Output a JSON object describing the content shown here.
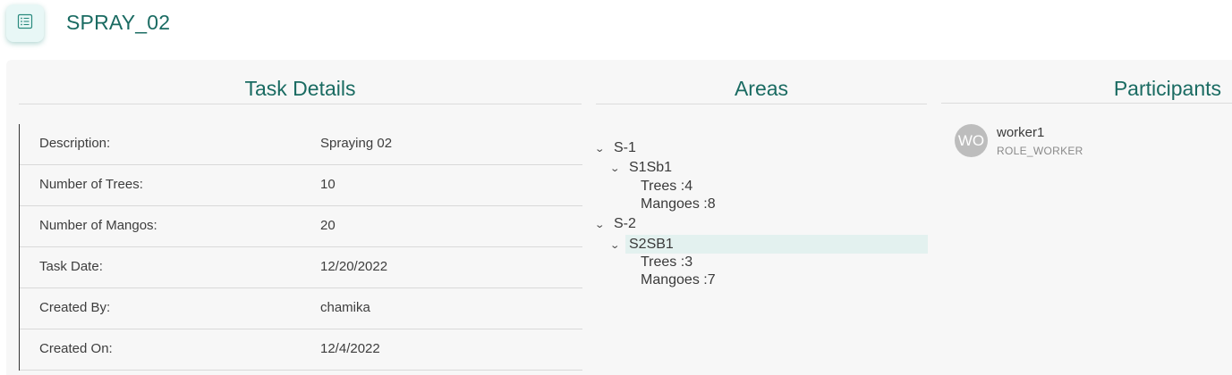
{
  "header": {
    "title": "SPRAY_02",
    "icon": "list-icon"
  },
  "sections": {
    "details_title": "Task Details",
    "areas_title": "Areas",
    "participants_title": "Participants"
  },
  "task_details": [
    {
      "label": "Description:",
      "value": "Spraying 02"
    },
    {
      "label": "Number of Trees:",
      "value": "10"
    },
    {
      "label": "Number of Mangos:",
      "value": "20"
    },
    {
      "label": "Task Date:",
      "value": "12/20/2022"
    },
    {
      "label": "Created By:",
      "value": "chamika"
    },
    {
      "label": "Created On:",
      "value": "12/4/2022"
    }
  ],
  "areas": {
    "nodes": [
      {
        "label": "S-1"
      },
      {
        "label": "S1Sb1"
      },
      {
        "label": "Trees :4"
      },
      {
        "label": "Mangoes :8"
      },
      {
        "label": "S-2"
      },
      {
        "label": "S2SB1",
        "selected": true
      },
      {
        "label": "Trees :3"
      },
      {
        "label": "Mangoes :7"
      }
    ]
  },
  "participants": [
    {
      "initials": "WO",
      "name": "worker1",
      "role": "ROLE_WORKER"
    }
  ],
  "colors": {
    "accent": "#1a6b62",
    "selected_bg": "#e3f1ef",
    "card_bg": "#f7f7f7",
    "avatar_bg": "#bdbdbd"
  }
}
